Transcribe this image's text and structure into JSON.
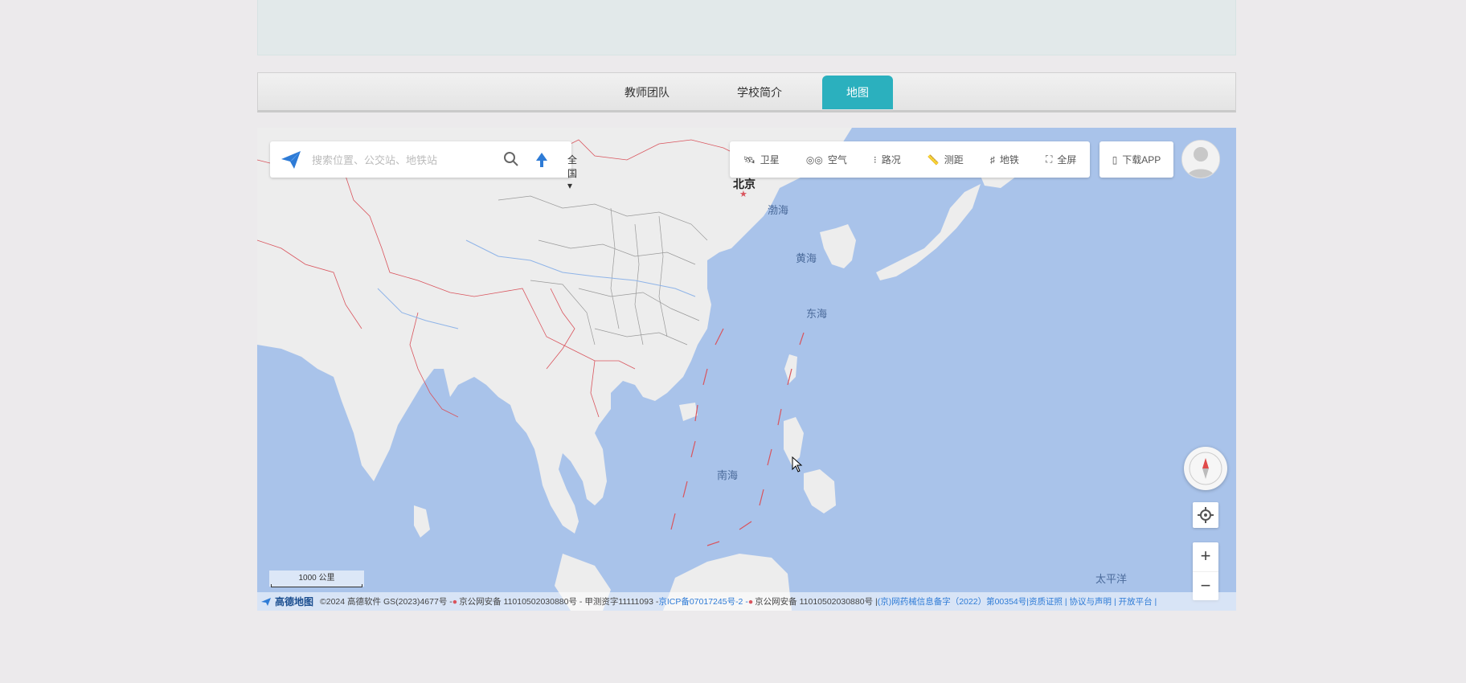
{
  "nav": {
    "items": [
      {
        "label": "教师团队",
        "active": false
      },
      {
        "label": "学校简介",
        "active": false
      },
      {
        "label": "地图",
        "active": true
      }
    ],
    "active_color": "#2bb0be"
  },
  "map": {
    "search": {
      "placeholder": "搜索位置、公交站、地铁站",
      "region": "全国"
    },
    "toolbar": [
      "卫星",
      "空气",
      "路况",
      "测距",
      "地铁",
      "全屏"
    ],
    "download_label": "下载APP",
    "labels": {
      "beijing": "北京",
      "bohai": "渤海",
      "huanghai": "黄海",
      "donghai": "东海",
      "nanhai": "南海",
      "pacific": "太平洋"
    },
    "scale": "1000 公里",
    "brand": "高德地图",
    "footer": {
      "copyright": "©2024 高德软件 GS(2023)4677号 - ",
      "police1": "京公网安备 11010502030880号 - 甲测资字11111093 - ",
      "icp": "京ICP备07017245号-2 - ",
      "police2": "京公网安备 11010502030880号 | ",
      "links": "(京)网药械信息备字（2022）第00354号|资质证照 | 协议与声明 | 开放平台 |"
    },
    "colors": {
      "sea": "#a9c3ea",
      "land": "#ededed",
      "border": "#d9545d"
    }
  }
}
